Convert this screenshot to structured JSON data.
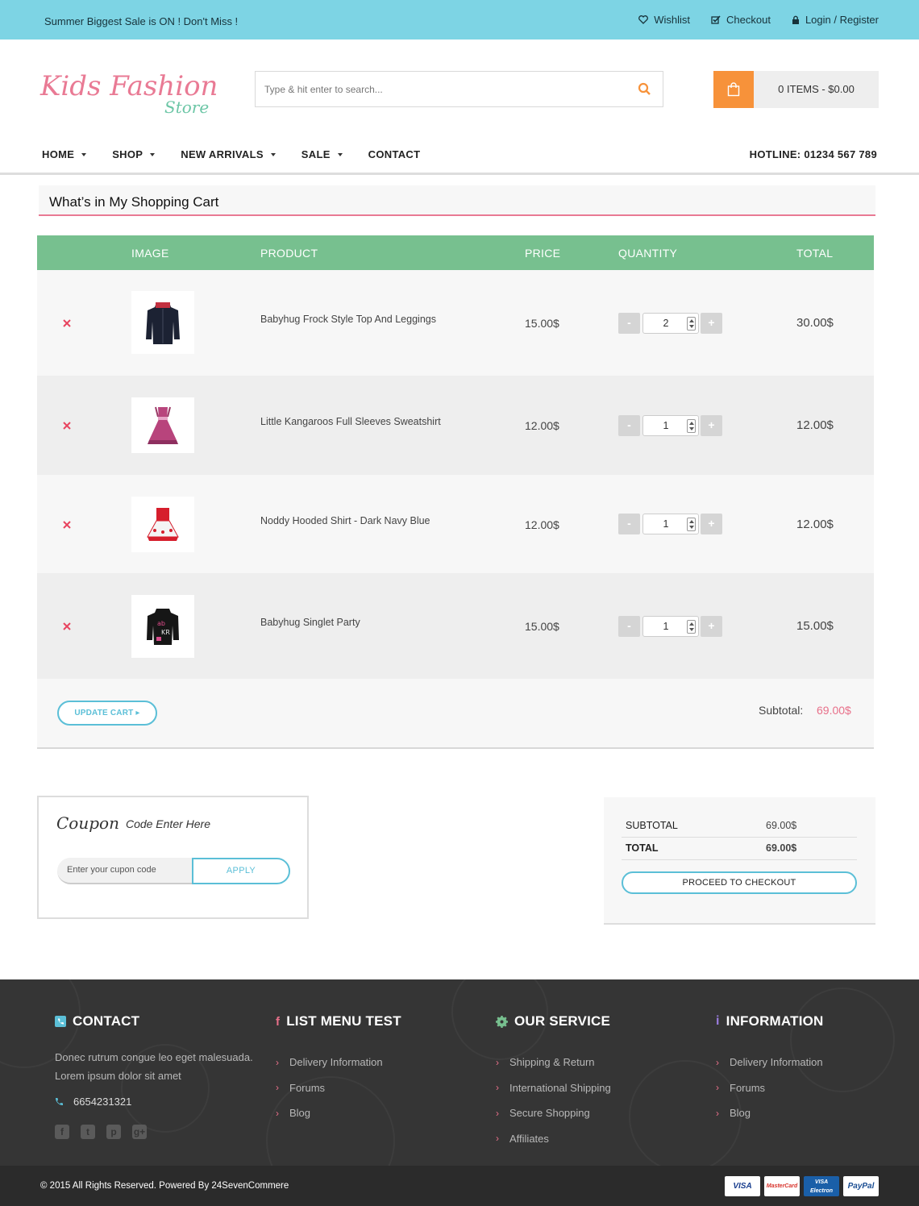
{
  "topbar": {
    "promo": "Summer Biggest Sale is ON ! Don't Miss !",
    "wishlist": "Wishlist",
    "checkout": "Checkout",
    "login": "Login / Register"
  },
  "header": {
    "logo_line1": "Kids Fashion",
    "logo_line2": "Store",
    "search_placeholder": "Type & hit enter to search...",
    "cart_label": "0 ITEMS - $0.00"
  },
  "nav": {
    "items": [
      "HOME",
      "SHOP",
      "NEW ARRIVALS",
      "SALE",
      "CONTACT"
    ],
    "hotline": "HOTLINE: 01234 567 789"
  },
  "cart": {
    "title": "What’s in My Shopping Cart",
    "columns": [
      "IMAGE",
      "PRODUCT",
      "PRICE",
      "QUANTITY",
      "TOTAL"
    ],
    "rows": [
      {
        "product": "Babyhug Frock Style Top And Leggings",
        "price": "15.00$",
        "qty": "2",
        "total": "30.00$",
        "image": "navy-jacket"
      },
      {
        "product": "Little Kangaroos Full Sleeves Sweatshirt",
        "price": "12.00$",
        "qty": "1",
        "total": "12.00$",
        "image": "pink-dress"
      },
      {
        "product": "Noddy Hooded Shirt - Dark Navy Blue",
        "price": "12.00$",
        "qty": "1",
        "total": "12.00$",
        "image": "red-white-dress"
      },
      {
        "product": "Babyhug Singlet Party",
        "price": "15.00$",
        "qty": "1",
        "total": "15.00$",
        "image": "black-printed-jacket"
      }
    ],
    "minus": "-",
    "plus": "+",
    "update_label": "UPDATE CART ▸",
    "subtotal_label": "Subtotal:",
    "subtotal_value": "69.00$"
  },
  "coupon": {
    "script_word": "Coupon",
    "subtitle": "Code Enter Here",
    "placeholder": "Enter your cupon code",
    "apply_label": "APPLY"
  },
  "totals": {
    "subtotal_label": "SUBTOTAL",
    "subtotal_value": "69.00$",
    "total_label": "TOTAL",
    "total_value": "69.00$",
    "checkout_label": "PROCEED TO CHECKOUT"
  },
  "footer": {
    "contact": {
      "heading": "CONTACT",
      "desc": "Donec rutrum congue leo eget malesuada. Lorem ipsum dolor sit amet",
      "phone": "6654231321",
      "social": [
        "f",
        "t",
        "p",
        "g+"
      ]
    },
    "menu": {
      "heading": "LIST MENU TEST",
      "items": [
        "Delivery Information",
        "Forums",
        "Blog"
      ]
    },
    "service": {
      "heading": "OUR SERVICE",
      "items": [
        "Shipping & Return",
        "International Shipping",
        "Secure Shopping",
        "Affiliates"
      ]
    },
    "info": {
      "heading": "INFORMATION",
      "items": [
        "Delivery Information",
        "Forums",
        "Blog"
      ]
    },
    "copyright": "© 2015 All Rights Reserved. Powered By 24SevenCommere",
    "payments": [
      "VISA",
      "MasterCard",
      "VISA Electron",
      "PayPal"
    ]
  },
  "colors": {
    "topbar": "#7dd4e4",
    "table_header": "#77c08f",
    "accent_pink": "#e8708a",
    "accent_blue": "#5bbfd7",
    "cart_orange": "#f7923a",
    "footer": "#353535"
  }
}
